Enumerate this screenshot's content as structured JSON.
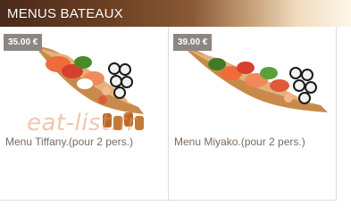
{
  "header": {
    "title": "MENUS BATEAUX"
  },
  "menus": [
    {
      "price": "35.00 €",
      "name": "Menu Tiffany.(pour 2 pers.)"
    },
    {
      "price": "39.00 €",
      "name": "Menu Miyako.(pour 2 pers.)"
    }
  ],
  "watermark": "eat-list.fr"
}
